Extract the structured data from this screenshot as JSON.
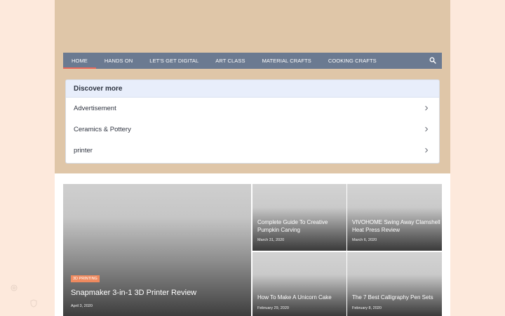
{
  "nav": {
    "items": [
      {
        "label": "HOME"
      },
      {
        "label": "HANDS ON"
      },
      {
        "label": "LET'S GET DIGITAL"
      },
      {
        "label": "ART CLASS"
      },
      {
        "label": "MATERIAL CRAFTS"
      },
      {
        "label": "COOKING CRAFTS"
      }
    ],
    "search_icon": "search-icon"
  },
  "discover": {
    "title": "Discover more",
    "items": [
      {
        "label": "Advertisement"
      },
      {
        "label": "Ceramics & Pottery"
      },
      {
        "label": "printer"
      }
    ]
  },
  "featured": {
    "main": {
      "badge": "3D PRINTING",
      "title": "Snapmaker 3-in-1 3D Printer Review",
      "date": "April 3, 2020"
    },
    "cards": [
      {
        "title": "Complete Guide To Creative Pumpkin Carving",
        "date": "March 31, 2020"
      },
      {
        "title": "VIVOHOME Swing Away Clamshell Heat Press Review",
        "date": "March 6, 2020"
      },
      {
        "title": "How To Make A Unicorn Cake",
        "date": "February 29, 2020"
      },
      {
        "title": "The 7 Best Calligraphy Pen Sets",
        "date": "February 8, 2020"
      }
    ]
  },
  "colors": {
    "background": "#fde9dc",
    "header": "#dfc6a8",
    "nav": "#6b7a91",
    "accent": "#e8695a",
    "badge": "#ef8a5f"
  }
}
